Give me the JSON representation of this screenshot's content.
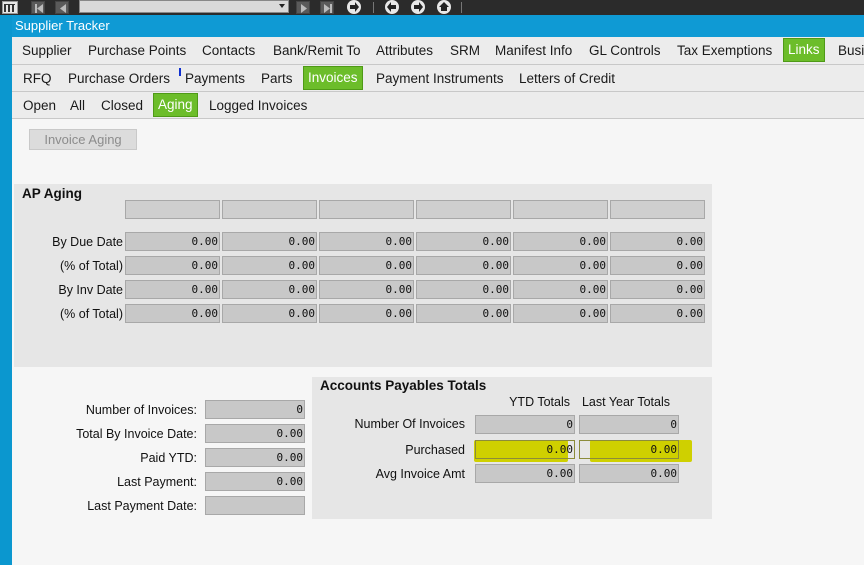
{
  "toolbar": {
    "icons": [
      "menu-icon",
      "first-record-icon",
      "prev-record-icon",
      "next-record-icon",
      "last-record-icon",
      "go-icon",
      "back-icon",
      "forward-icon",
      "home-icon"
    ]
  },
  "window": {
    "title": "Supplier Tracker"
  },
  "tabs_main": [
    "Supplier",
    "Purchase Points",
    "Contacts",
    "Bank/Remit To",
    "Attributes",
    "SRM",
    "Manifest Info",
    "GL Controls",
    "Tax Exemptions",
    "Links",
    "Busi"
  ],
  "tabs_links": [
    "RFQ",
    "Purchase Orders",
    "Payments",
    "Parts",
    "Invoices",
    "Payment Instruments",
    "Letters of Credit"
  ],
  "tabs_invoices": [
    "Open",
    "All",
    "Closed",
    "Aging",
    "Logged Invoices"
  ],
  "invoice_aging_button": "Invoice Aging",
  "ap_aging": {
    "title": "AP Aging",
    "rows": [
      {
        "label": "By Due Date",
        "values": [
          "0.00",
          "0.00",
          "0.00",
          "0.00",
          "0.00",
          "0.00"
        ]
      },
      {
        "label": "(% of Total)",
        "values": [
          "0.00",
          "0.00",
          "0.00",
          "0.00",
          "0.00",
          "0.00"
        ]
      },
      {
        "label": "By Inv Date",
        "values": [
          "0.00",
          "0.00",
          "0.00",
          "0.00",
          "0.00",
          "0.00"
        ]
      },
      {
        "label": "(% of Total)",
        "values": [
          "0.00",
          "0.00",
          "0.00",
          "0.00",
          "0.00",
          "0.00"
        ]
      }
    ]
  },
  "invoice_summary": [
    {
      "label": "Number of Invoices:",
      "value": "0"
    },
    {
      "label": "Total By Invoice Date:",
      "value": "0.00"
    },
    {
      "label": "Paid YTD:",
      "value": "0.00"
    },
    {
      "label": "Last Payment:",
      "value": "0.00"
    },
    {
      "label": "Last Payment Date:",
      "value": ""
    }
  ],
  "ap_totals": {
    "title": "Accounts Payables Totals",
    "col_ytd": "YTD Totals",
    "col_last_year": "Last Year Totals",
    "rows": [
      {
        "label": "Number Of Invoices",
        "ytd": "0",
        "last_year": "0"
      },
      {
        "label": "Purchased",
        "ytd": "0.00",
        "last_year": "0.00"
      },
      {
        "label": "Avg Invoice Amt",
        "ytd": "0.00",
        "last_year": "0.00"
      }
    ]
  },
  "colors": {
    "title_bar": "#0f9ad4",
    "active_tab": "#6cbd2a",
    "highlight": "#cfd000"
  }
}
